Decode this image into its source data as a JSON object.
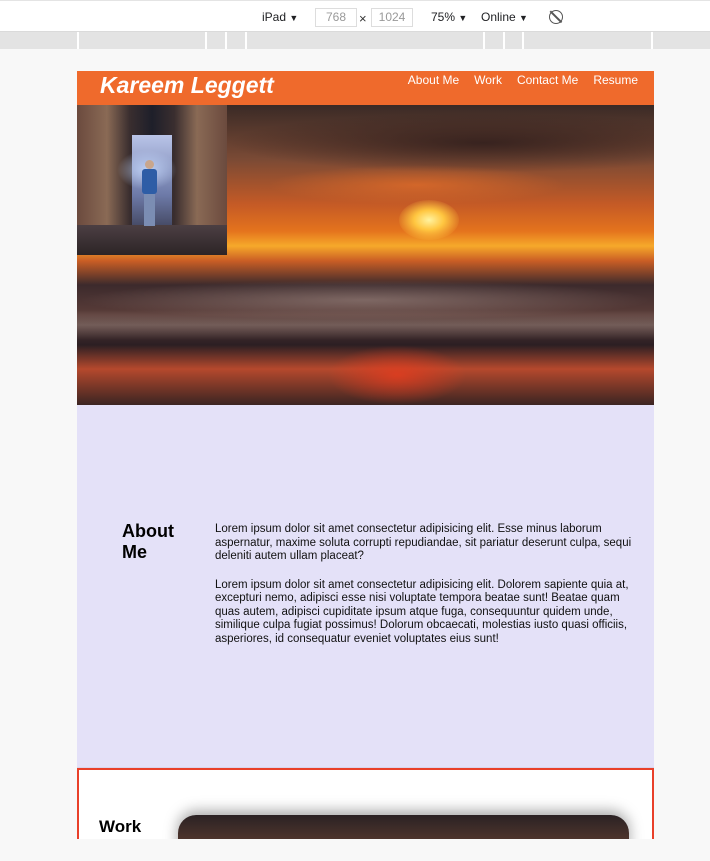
{
  "devtools": {
    "device": "iPad",
    "width": "768",
    "height": "1024",
    "times": "×",
    "zoom": "75%",
    "network": "Online",
    "caret": "▼"
  },
  "site": {
    "brand": "Kareem Leggett",
    "nav": [
      "About Me",
      "Work",
      "Contact Me",
      "Resume"
    ],
    "about": {
      "title": "About Me",
      "paragraphs": [
        "Lorem ipsum dolor sit amet consectetur adipisicing elit. Esse minus laborum aspernatur, maxime soluta corrupti repudiandae, sit pariatur deserunt culpa, sequi deleniti autem ullam placeat?",
        "Lorem ipsum dolor sit amet consectetur adipisicing elit. Dolorem sapiente quia at, excepturi nemo, adipisci esse nisi voluptate tempora beatae sunt! Beatae quam quas autem, adipisci cupiditate ipsum atque fuga, consequuntur quidem unde, similique culpa fugiat possimus! Dolorum obcaecati, molestias iusto quasi officiis, asperiores, id consequatur eveniet voluptates eius sunt!"
      ]
    },
    "work": {
      "title": "Work"
    }
  },
  "colors": {
    "header": "#ef6a2c",
    "about_bg": "#e4e1f8",
    "work_border": "#e9402a"
  },
  "icons": {
    "rotate": "rotate-icon"
  }
}
